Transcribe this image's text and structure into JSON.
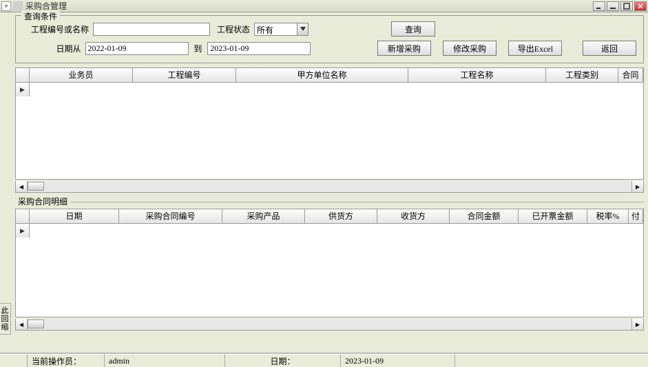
{
  "window": {
    "title": "采购合管理"
  },
  "query": {
    "legend": "查询条件",
    "labels": {
      "project_code_or_name": "工程编号或名称",
      "status": "工程状态",
      "date_from": "日期从",
      "date_to": "到"
    },
    "values": {
      "project_code_or_name": "",
      "status": "所有",
      "date_from": "2022-01-09",
      "date_to": "2023-01-09"
    },
    "buttons": {
      "search": "查询",
      "add": "新增采购",
      "edit": "修改采购",
      "export": "导出Excel",
      "back": "返回"
    }
  },
  "table1": {
    "columns": [
      "业务员",
      "工程编号",
      "甲方单位名称",
      "工程名称",
      "工程类别",
      "合同"
    ]
  },
  "detail": {
    "legend": "采购合同明细",
    "columns": [
      "日期",
      "采购合同编号",
      "采购产品",
      "供货方",
      "收货方",
      "合同金额",
      "已开票金额",
      "税率%",
      "付"
    ]
  },
  "statusbar": {
    "operator_label": "当前操作员：",
    "operator": "admin",
    "date_label": "日期：",
    "date": "2023-01-09"
  },
  "sidetab": "此回缩"
}
